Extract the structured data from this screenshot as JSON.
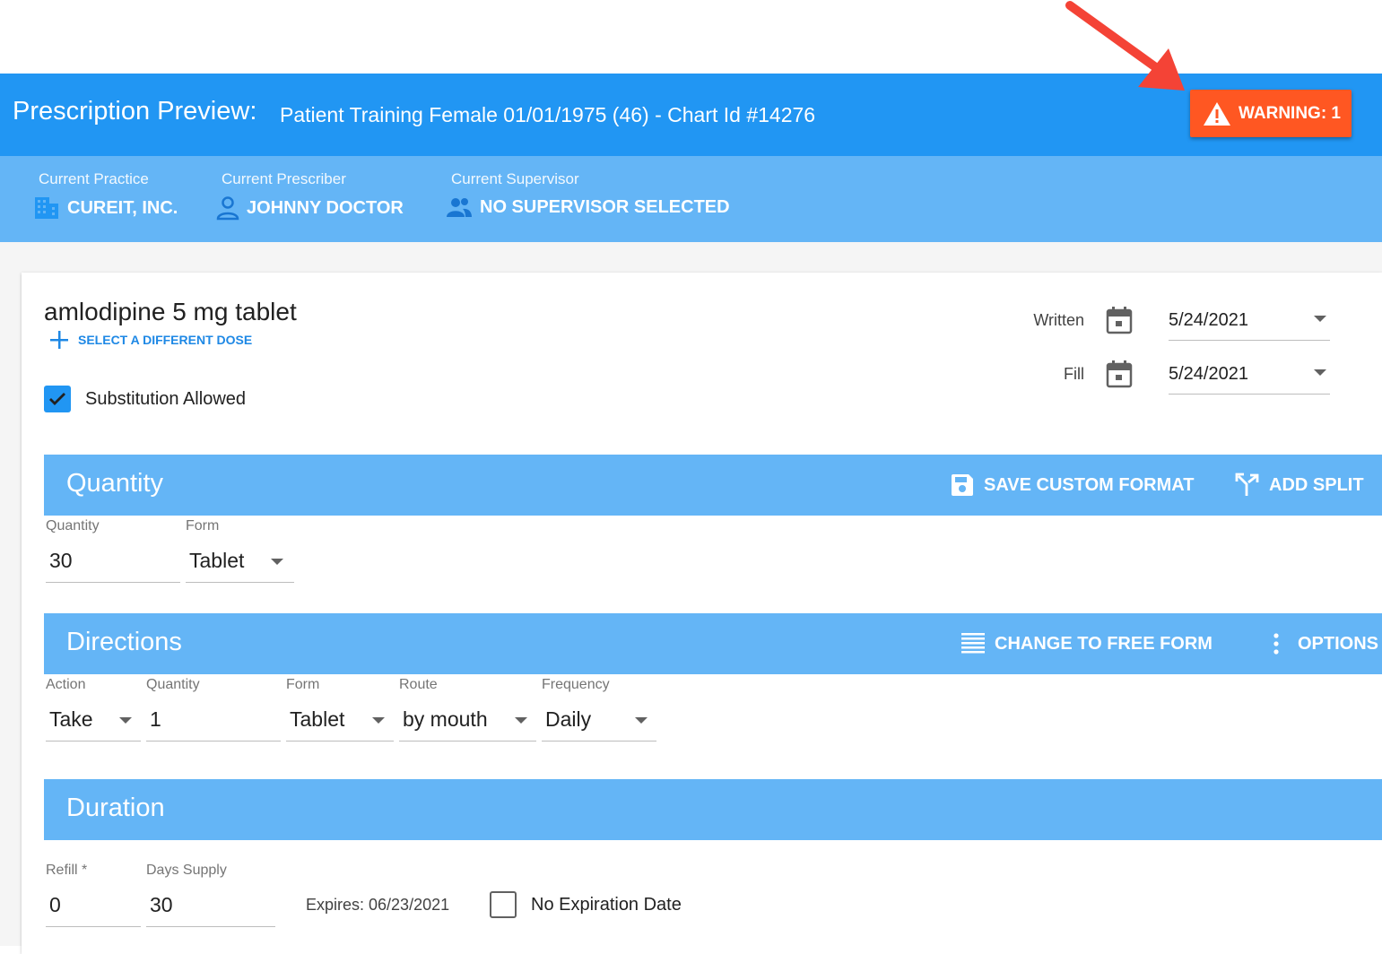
{
  "header": {
    "title": "Prescription Preview:",
    "patient": "Patient Training Female 01/01/1975 (46) - Chart Id #14276",
    "warning_label": "WARNING: 1",
    "colors": {
      "header": "#2196f3",
      "subbar": "#64b5f6",
      "warning": "#ff5722",
      "annotation_arrow": "#f44336"
    }
  },
  "context": {
    "practice": {
      "label": "Current Practice",
      "value": "CUREIT, INC.",
      "icon": "building-icon"
    },
    "prescriber": {
      "label": "Current Prescriber",
      "value": "JOHNNY DOCTOR",
      "icon": "person-icon"
    },
    "supervisor": {
      "label": "Current Supervisor",
      "value": "NO SUPERVISOR SELECTED",
      "icon": "people-icon"
    }
  },
  "drug": {
    "name": "amlodipine 5 mg tablet",
    "select_dose": "SELECT A DIFFERENT DOSE",
    "substitution_label": "Substitution Allowed",
    "substitution_checked": true
  },
  "dates": {
    "written": {
      "label": "Written",
      "value": "5/24/2021"
    },
    "fill": {
      "label": "Fill",
      "value": "5/24/2021"
    }
  },
  "quantity": {
    "title": "Quantity",
    "save_custom_format": "SAVE CUSTOM FORMAT",
    "add_split": "ADD SPLIT",
    "fields": {
      "quantity": {
        "label": "Quantity",
        "value": "30"
      },
      "form": {
        "label": "Form",
        "value": "Tablet"
      }
    }
  },
  "directions": {
    "title": "Directions",
    "change_free_form": "CHANGE TO FREE FORM",
    "options": "OPTIONS",
    "fields": {
      "action": {
        "label": "Action",
        "value": "Take"
      },
      "quantity": {
        "label": "Quantity",
        "value": "1"
      },
      "form": {
        "label": "Form",
        "value": "Tablet"
      },
      "route": {
        "label": "Route",
        "value": "by mouth"
      },
      "frequency": {
        "label": "Frequency",
        "value": "Daily"
      }
    }
  },
  "duration": {
    "title": "Duration",
    "fields": {
      "refill": {
        "label": "Refill *",
        "value": "0"
      },
      "days_supply": {
        "label": "Days Supply",
        "value": "30"
      }
    },
    "expires": "Expires: 06/23/2021",
    "no_expiration_label": "No Expiration Date",
    "no_expiration_checked": false
  }
}
